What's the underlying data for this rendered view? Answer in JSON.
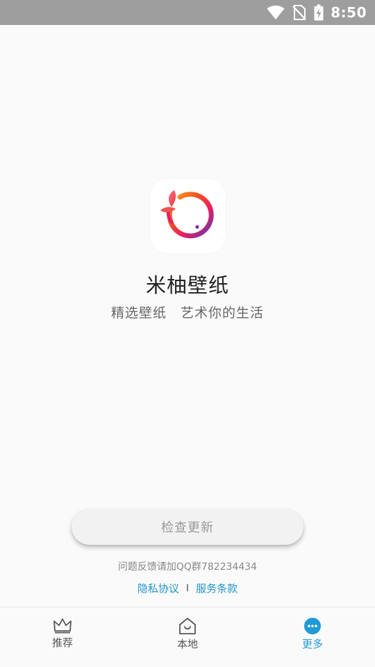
{
  "status_bar": {
    "time": "8:50",
    "icons": [
      "wifi-icon",
      "no-sim-icon",
      "battery-charging-icon"
    ]
  },
  "app": {
    "name": "米柚壁纸",
    "slogan": "精选壁纸　艺术你的生活",
    "logo_icon": "miyou-logo-icon"
  },
  "actions": {
    "check_update": "检查更新"
  },
  "footer": {
    "feedback": "问题反馈请加QQ群782234434",
    "privacy": "隐私协议",
    "separator": "I",
    "terms": "服务条款"
  },
  "tabs": [
    {
      "label": "推荐",
      "icon": "crown-icon",
      "active": false
    },
    {
      "label": "本地",
      "icon": "home-icon",
      "active": false
    },
    {
      "label": "更多",
      "icon": "more-icon",
      "active": true
    }
  ],
  "colors": {
    "accent": "#1e9bd7",
    "link": "#2196c9",
    "status_bar": "#9e9e9e"
  }
}
